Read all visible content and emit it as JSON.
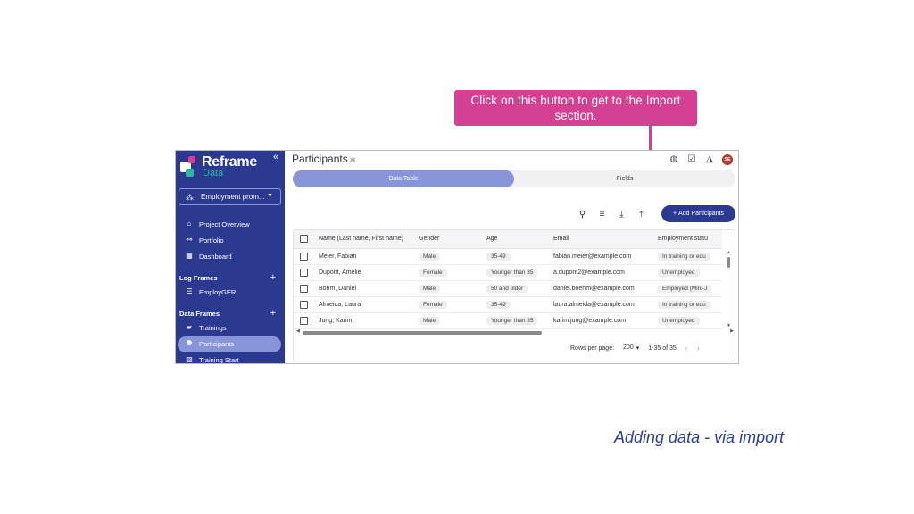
{
  "callout": {
    "text": "Click on this button to get to the Import section."
  },
  "caption": "Adding data - via import",
  "colors": {
    "sidebar": "#2b3990",
    "accent": "#8896d9",
    "callout": "#d44092",
    "brand_teal": "#2bb6a8"
  },
  "sidebar": {
    "logo_top": "Reframe",
    "logo_bottom": "Data",
    "project": "Employment prom...",
    "nav": [
      {
        "label": "Project Overview",
        "icon": "home-icon"
      },
      {
        "label": "Portfolio",
        "icon": "portfolio-icon"
      },
      {
        "label": "Dashboard",
        "icon": "dashboard-icon"
      }
    ],
    "log_frames": {
      "title": "Log Frames",
      "items": [
        {
          "label": "EmployGER",
          "icon": "list-icon"
        }
      ]
    },
    "data_frames": {
      "title": "Data Frames",
      "items": [
        {
          "label": "Trainings",
          "icon": "briefcase-icon"
        },
        {
          "label": "Participants",
          "icon": "people-icon",
          "active": true
        },
        {
          "label": "Training Start",
          "icon": "image-icon"
        }
      ]
    }
  },
  "header": {
    "title": "Participants",
    "avatar": "SE"
  },
  "tabs": {
    "data_table": "Data Table",
    "fields": "Fields"
  },
  "toolbar": {
    "add_label": "Add Participants"
  },
  "table": {
    "columns": [
      "Name (Last name, First name)",
      "Gender",
      "Age",
      "Email",
      "Employment statu"
    ],
    "rows": [
      [
        "Meier, Fabian",
        "Male",
        "35-49",
        "fabian.meier@example.com",
        "In training or edu"
      ],
      [
        "Dupont, Amélie",
        "Female",
        "Younger than 35",
        "a.dupont2@example.com",
        "Unemployed"
      ],
      [
        "Böhm, Daniel",
        "Male",
        "50 and older",
        "daniel.boehm@example.com",
        "Employed (Mini-J"
      ],
      [
        "Almeida, Laura",
        "Female",
        "35-49",
        "laura.almeida@example.com",
        "In training or edu"
      ],
      [
        "Jung, Karim",
        "Male",
        "Younger than 35",
        "karim.jung@example.com",
        "Unemployed"
      ]
    ]
  },
  "pager": {
    "rows_label": "Rows per page:",
    "rows_value": "200",
    "range": "1-35 of 35"
  }
}
